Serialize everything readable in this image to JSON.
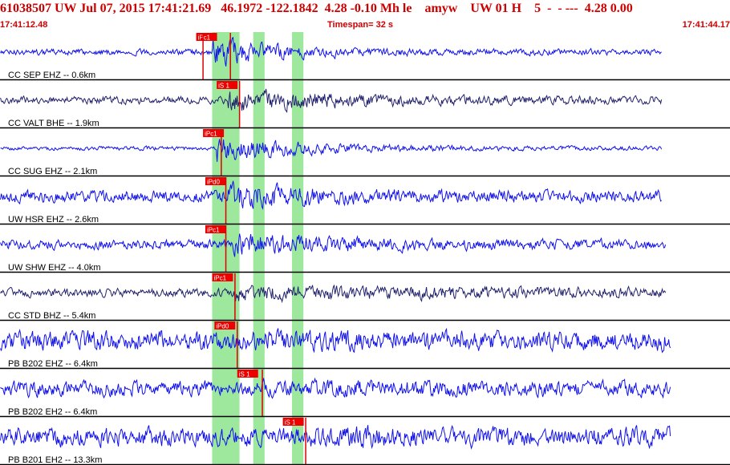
{
  "header": {
    "title": "61038507 UW Jul 07, 2015 17:41:21.69   46.1972 -122.1842  4.28 -0.10 Mh le    amyw    UW 01 H    5  -  - ---  4.28 0.00",
    "start_time": "17:41:12.48",
    "timespan": "Timespan=  32 s",
    "end_time": "17:41:44.17"
  },
  "colors": {
    "header_text": "#cc0000",
    "trace_blue": "#1111ee",
    "trace_dark": "#22226e",
    "pick_box": "#ee0000",
    "pick_line": "#dd0000",
    "window_band": "#9ee89e",
    "divider": "#000000"
  },
  "chart_data": {
    "type": "line",
    "title": "61038507 UW Jul 07, 2015 17:41:21.69",
    "x_unit": "s",
    "xlim": [
      0,
      32
    ],
    "series": [
      {
        "name": "CC SEP EHZ -- 0.6km",
        "color": "trace_blue",
        "amplitude": 0.18,
        "onset": 9.3,
        "burst": 0.9,
        "decay": 3.0,
        "end": 29.0,
        "picks": [
          {
            "label": "iPc1",
            "t": 8.6,
            "line": 8.9
          },
          {
            "label": "",
            "t": 10.0,
            "line": 10.1
          }
        ]
      },
      {
        "name": "CC VALT BHE -- 1.9km",
        "color": "trace_dark",
        "amplitude": 0.22,
        "onset": 10.0,
        "burst": 0.75,
        "decay": 6.0,
        "end": 29.0,
        "picks": [
          {
            "label": "iS 1",
            "t": 9.5,
            "line": 10.5
          }
        ]
      },
      {
        "name": "CC SUG EHZ -- 2.1km",
        "color": "trace_blue",
        "amplitude": 0.12,
        "onset": 9.5,
        "burst": 0.8,
        "decay": 4.0,
        "end": 29.0,
        "picks": [
          {
            "label": "iPc1",
            "t": 8.9,
            "line": 9.7
          }
        ]
      },
      {
        "name": "UW HSR EHZ -- 2.6km",
        "color": "trace_blue",
        "amplitude": 0.35,
        "onset": 10.0,
        "burst": 0.95,
        "decay": 3.5,
        "end": 29.0,
        "picks": [
          {
            "label": "iPd0",
            "t": 9.0,
            "line": 9.9
          }
        ]
      },
      {
        "name": "UW SHW EHZ -- 4.0km",
        "color": "trace_blue",
        "amplitude": 0.28,
        "onset": 10.2,
        "burst": 0.8,
        "decay": 5.0,
        "end": 29.2,
        "picks": [
          {
            "label": "iPc1",
            "t": 9.0,
            "line": 9.9
          }
        ]
      },
      {
        "name": "CC STD BHZ -- 5.4km",
        "color": "trace_dark",
        "amplitude": 0.25,
        "onset": 10.2,
        "burst": 0.55,
        "decay": 12.0,
        "end": 29.2,
        "picks": [
          {
            "label": "iPc1",
            "t": 9.3,
            "line": 10.3
          }
        ]
      },
      {
        "name": "PB B202 EHZ -- 6.4km",
        "color": "trace_blue",
        "amplitude": 0.6,
        "onset": 10.3,
        "burst": 0.35,
        "decay": 8.0,
        "end": 29.4,
        "picks": [
          {
            "label": "iPd0",
            "t": 9.4,
            "line": 10.4
          }
        ]
      },
      {
        "name": "PB B202 EH2 -- 6.4km",
        "color": "trace_blue",
        "amplitude": 0.45,
        "onset": 11.5,
        "burst": 0.6,
        "decay": 6.0,
        "end": 29.4,
        "picks": [
          {
            "label": "iS 1",
            "t": 10.4,
            "line": 11.5
          }
        ]
      },
      {
        "name": "PB B201 EH2 -- 13.3km",
        "color": "trace_blue",
        "amplitude": 0.55,
        "onset": 13.4,
        "burst": 0.7,
        "decay": 6.0,
        "end": 29.4,
        "picks": [
          {
            "label": "iS 1",
            "t": 12.4,
            "line": 13.4
          }
        ]
      }
    ],
    "windows": [
      {
        "t_start": 9.3,
        "t_end": 9.9
      },
      {
        "t_start": 9.9,
        "t_end": 10.5
      },
      {
        "t_start": 11.1,
        "t_end": 11.6
      },
      {
        "t_start": 12.8,
        "t_end": 13.3
      }
    ]
  }
}
